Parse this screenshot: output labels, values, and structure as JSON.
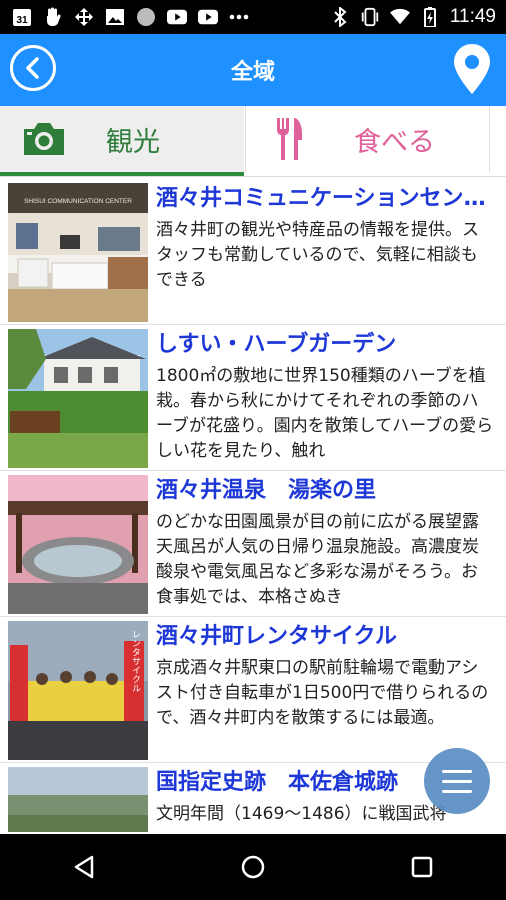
{
  "status_bar": {
    "time": "11:49",
    "left_icons": [
      "calendar-icon",
      "hand-icon",
      "network-icon",
      "image-icon",
      "circle-icon",
      "youtube-icon",
      "youtube-icon",
      "more-icon"
    ],
    "right_icons": [
      "bluetooth-icon",
      "vibrate-icon",
      "wifi-icon",
      "battery-icon"
    ],
    "calendar_day": "31"
  },
  "app_bar": {
    "title": "全域",
    "color": "#1e90ff"
  },
  "tabs": [
    {
      "label": "観光",
      "icon": "camera-icon",
      "selected": true,
      "color": "#2e7d3a"
    },
    {
      "label": "食べる",
      "icon": "fork-knife-icon",
      "selected": false,
      "color": "#e0609a"
    }
  ],
  "spots": [
    {
      "title": "酒々井コミュニケーションセンター",
      "description": "酒々井町の観光や特産品の情報を提供。スタッフも常勤しているので、気軽に相談もできる",
      "sign_text": "SHISUI COMMUNICATION CENTER"
    },
    {
      "title": "しすい・ハーブガーデン",
      "description": "1800㎡の敷地に世界150種類のハーブを植栽。春から秋にかけてそれぞれの季節のハーブが花盛り。園内を散策してハーブの愛らしい花を見たり、触れ"
    },
    {
      "title": "酒々井温泉　湯楽の里",
      "description": "のどかな田園風景が目の前に広がる展望露天風呂が人気の日帰り温泉施設。高濃度炭酸泉や電気風呂など多彩な湯がそろう。お食事処では、本格さぬき"
    },
    {
      "title": "酒々井町レンタサイクル",
      "description": "京成酒々井駅東口の駅前駐輪場で電動アシスト付き自転車が1日500円で借りられるので、酒々井町内を散策するには最適。",
      "banner_text": "レンタサイクル"
    },
    {
      "title": "国指定史跡　本佐倉城跡",
      "description": "文明年間（1469～1486）に戦国武将"
    }
  ]
}
